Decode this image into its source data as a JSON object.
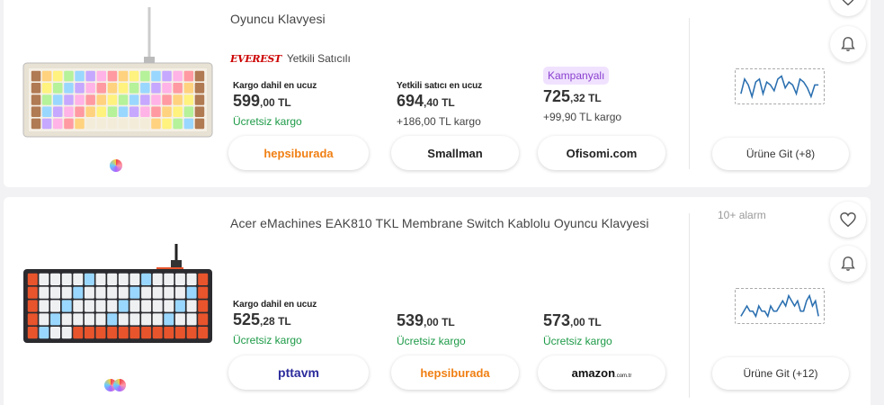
{
  "products": [
    {
      "title": "Oyuncu Klavyesi",
      "seller_brand": "EVEREST",
      "seller_label": "Yetkili Satıcılı",
      "offers": [
        {
          "label": "Kargo dahil en ucuz",
          "price_main": "599",
          "price_cents": ",00 TL",
          "shipping": "Ücretsiz kargo",
          "shipping_free": true,
          "store": "hepsiburada",
          "badge": ""
        },
        {
          "label": "Yetkili satıcı en ucuz",
          "price_main": "694",
          "price_cents": ",40 TL",
          "shipping": "+186,00 TL kargo",
          "shipping_free": false,
          "store": "Smallman",
          "badge": ""
        },
        {
          "label": "",
          "price_main": "725",
          "price_cents": ",32 TL",
          "shipping": "+99,90 TL kargo",
          "shipping_free": false,
          "store": "Ofisomi.com",
          "badge": "Kampanyalı"
        }
      ],
      "goto_label": "Ürüne Git (+8)",
      "alarm_text": "",
      "price_history": [
        3,
        8,
        6,
        2,
        7,
        8,
        3,
        7,
        6,
        4,
        8,
        9,
        5,
        7,
        6,
        3,
        8,
        7,
        5,
        2,
        6,
        6
      ]
    },
    {
      "title": "Acer eMachines EAK810 TKL Membrane Switch Kablolu Oyuncu Klavyesi",
      "seller_brand": "",
      "seller_label": "",
      "offers": [
        {
          "label": "Kargo dahil en ucuz",
          "price_main": "525",
          "price_cents": ",28 TL",
          "shipping": "Ücretsiz kargo",
          "shipping_free": true,
          "store": "pttavm",
          "badge": ""
        },
        {
          "label": "",
          "price_main": "539",
          "price_cents": ",00 TL",
          "shipping": "Ücretsiz kargo",
          "shipping_free": true,
          "store": "hepsiburada",
          "badge": ""
        },
        {
          "label": "",
          "price_main": "573",
          "price_cents": ",00 TL",
          "shipping": "Ücretsiz kargo",
          "shipping_free": true,
          "store": "amazon.com.tr",
          "badge": ""
        }
      ],
      "goto_label": "Ürüne Git (+12)",
      "alarm_text": "10+ alarm",
      "price_history": [
        4,
        5,
        6,
        5,
        5,
        4,
        6,
        5,
        5,
        4,
        6,
        5,
        5,
        6,
        7,
        6,
        8,
        7,
        6,
        7,
        5,
        5,
        7,
        8,
        6,
        7,
        4
      ]
    }
  ],
  "colors": {
    "green": "#1d9a47",
    "hepsiburada": "#f07f13",
    "pttavm": "#2c2c9c",
    "badge_bg": "#f0e2ff",
    "badge_text": "#8a3fcf",
    "chart_line": "#2a6fb0"
  },
  "icons": [
    "heart-icon",
    "bell-icon",
    "keyboard-image",
    "store-dots-icon"
  ]
}
